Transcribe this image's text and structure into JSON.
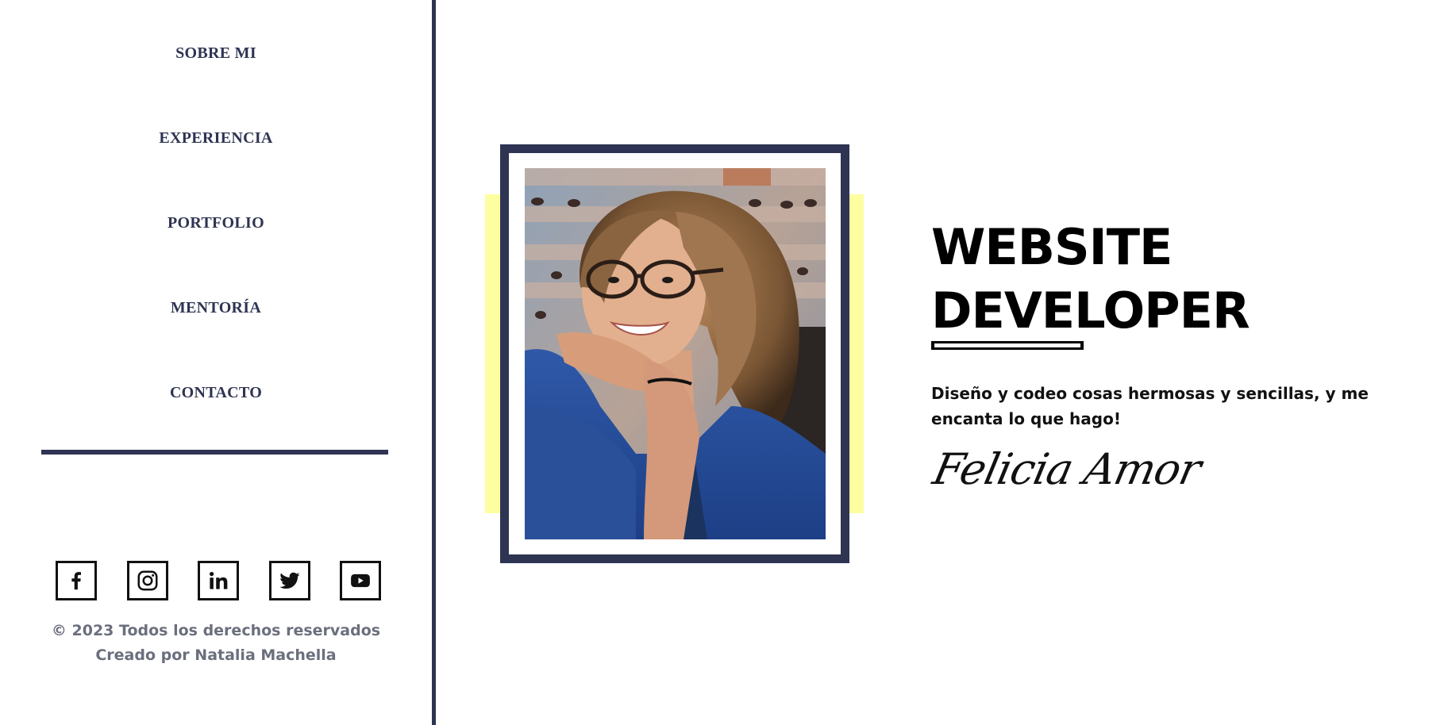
{
  "nav": {
    "items": [
      {
        "label": "SOBRE MI"
      },
      {
        "label": "EXPERIENCIA"
      },
      {
        "label": "PORTFOLIO"
      },
      {
        "label": "MENTORÍA"
      },
      {
        "label": "CONTACTO"
      }
    ]
  },
  "socials": [
    {
      "name": "facebook-icon"
    },
    {
      "name": "instagram-icon"
    },
    {
      "name": "linkedin-icon"
    },
    {
      "name": "twitter-icon"
    },
    {
      "name": "youtube-icon"
    }
  ],
  "footer": {
    "copyright": "© 2023 Todos los derechos reservados",
    "credit": "Creado por Natalia Machella"
  },
  "hero": {
    "title_line1": "WEBSITE",
    "title_line2": "DEVELOPER",
    "tagline": "Diseño y codeo cosas hermosas y sencillas, y me encanta lo que hago!",
    "signature": "Felicia Amor"
  },
  "colors": {
    "navy": "#2e3452",
    "accent_yellow": "#fdfea0",
    "text": "#000000",
    "muted": "#6b6f7d"
  }
}
